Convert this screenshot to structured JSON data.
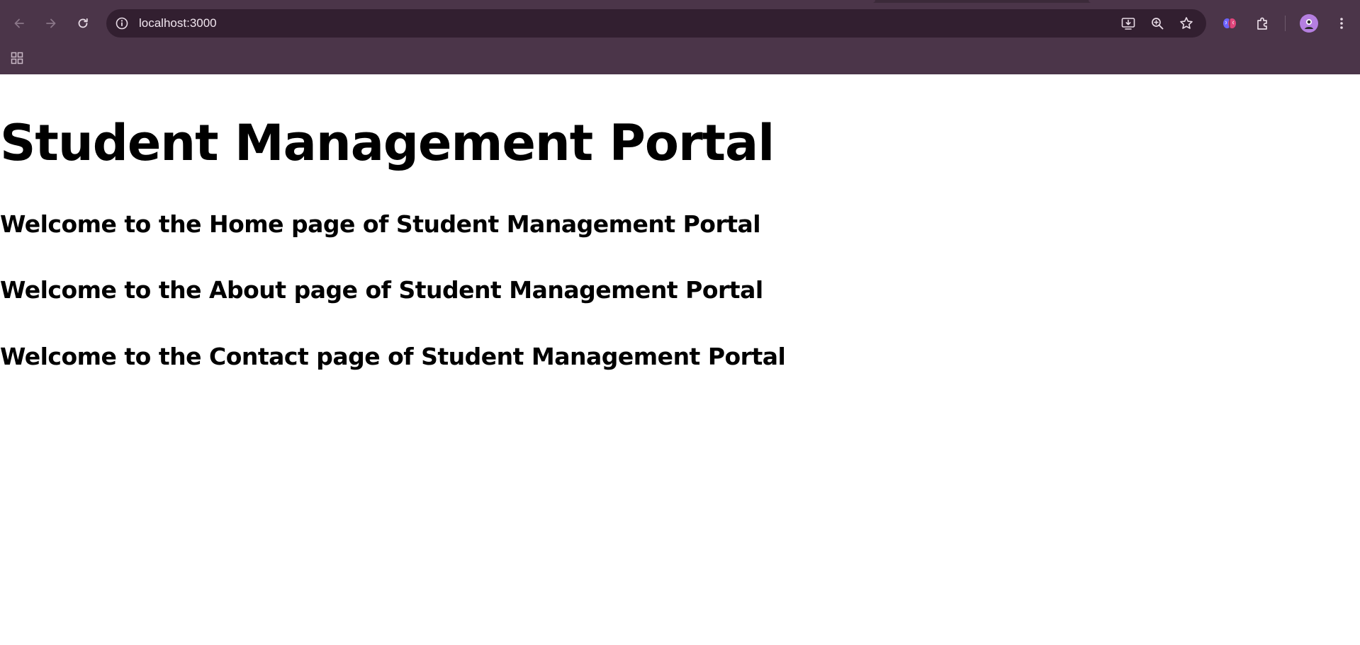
{
  "browser": {
    "url": "localhost:3000",
    "colors": {
      "chrome_bg": "#4b3549",
      "omnibox_bg": "#321f30",
      "icon_color": "#e8dbe6",
      "icon_disabled": "#8a7688",
      "avatar_bg": "#b57fe0"
    },
    "icons": {
      "back": "arrow-left-icon",
      "forward": "arrow-right-icon",
      "reload": "reload-icon",
      "site_info": "info-icon",
      "install": "install-app-icon",
      "zoom": "zoom-icon",
      "bookmark": "star-icon",
      "extension_brain": "brain-extension-icon",
      "extensions": "puzzle-icon",
      "profile": "avatar-icon",
      "menu": "kebab-menu-icon",
      "apps": "apps-grid-icon"
    }
  },
  "page": {
    "title": "Student Management Portal",
    "sections": [
      "Welcome to the Home page of Student Management Portal",
      "Welcome to the About page of Student Management Portal",
      "Welcome to the Contact page of Student Management Portal"
    ]
  }
}
